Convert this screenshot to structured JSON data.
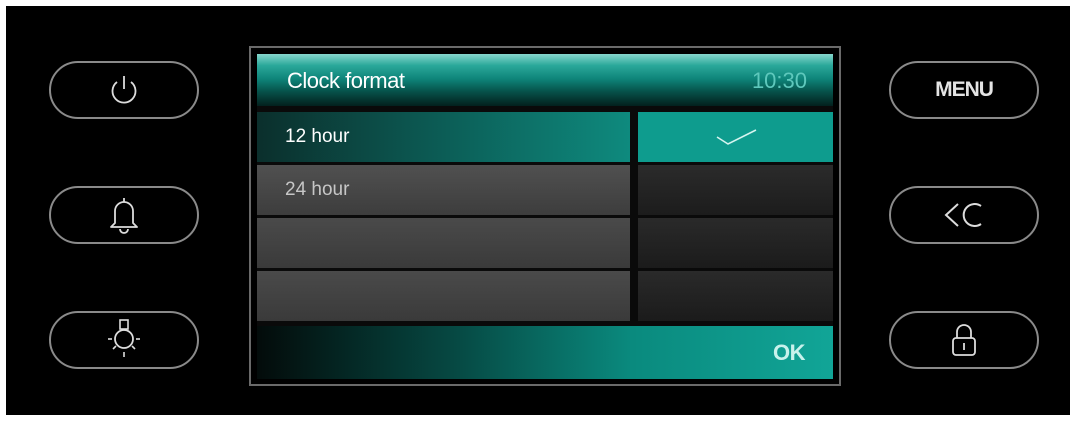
{
  "screen": {
    "title": "Clock format",
    "time": "10:30",
    "options": [
      {
        "label": "12 hour",
        "selected": true
      },
      {
        "label": "24 hour",
        "selected": false
      },
      {
        "label": "",
        "selected": false
      },
      {
        "label": "",
        "selected": false
      }
    ],
    "ok_label": "OK"
  },
  "buttons": {
    "left": [
      "power-icon",
      "bell-icon",
      "light-bulb-icon"
    ],
    "right_menu_label": "MENU",
    "right_icons": [
      "back-clear-icon",
      "lock-icon"
    ]
  },
  "colors": {
    "accent": "#0e9c8e",
    "background": "#000000",
    "frame": "#6a6a6a"
  }
}
